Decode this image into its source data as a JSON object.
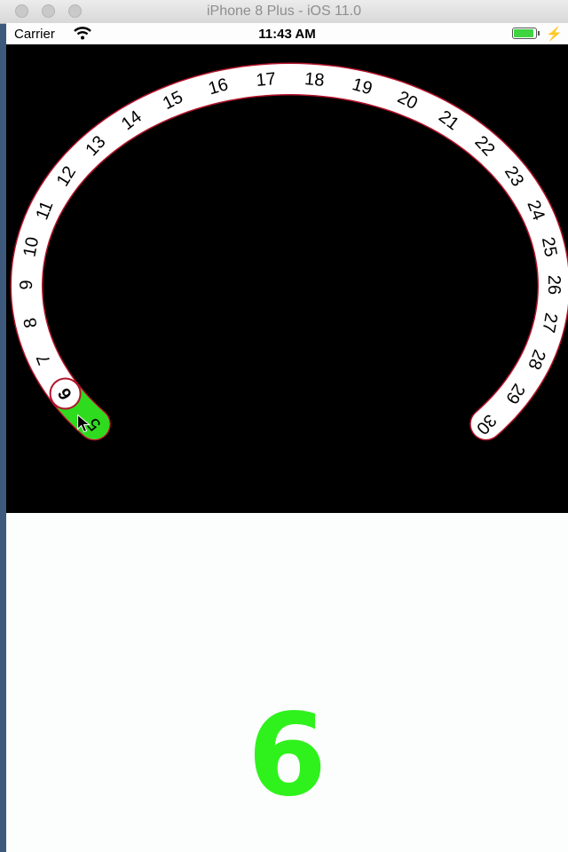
{
  "window": {
    "title": "iPhone 8 Plus - iOS 11.0"
  },
  "status_bar": {
    "carrier": "Carrier",
    "time": "11:43 AM",
    "charging_symbol": "⚡"
  },
  "dial": {
    "min_value": 5,
    "max_value": 30,
    "selected_value": 6,
    "numbers": [
      "5",
      "6",
      "7",
      "8",
      "9",
      "10",
      "11",
      "12",
      "13",
      "14",
      "15",
      "16",
      "17",
      "18",
      "19",
      "20",
      "21",
      "22",
      "23",
      "24",
      "25",
      "26",
      "27",
      "28",
      "29",
      "30"
    ],
    "track_color": "#ffffff",
    "track_outline_color": "#b2132a",
    "progress_color": "#2fdb1e",
    "background_color": "#000000"
  },
  "display": {
    "value": "6",
    "color": "#2ff21c"
  }
}
